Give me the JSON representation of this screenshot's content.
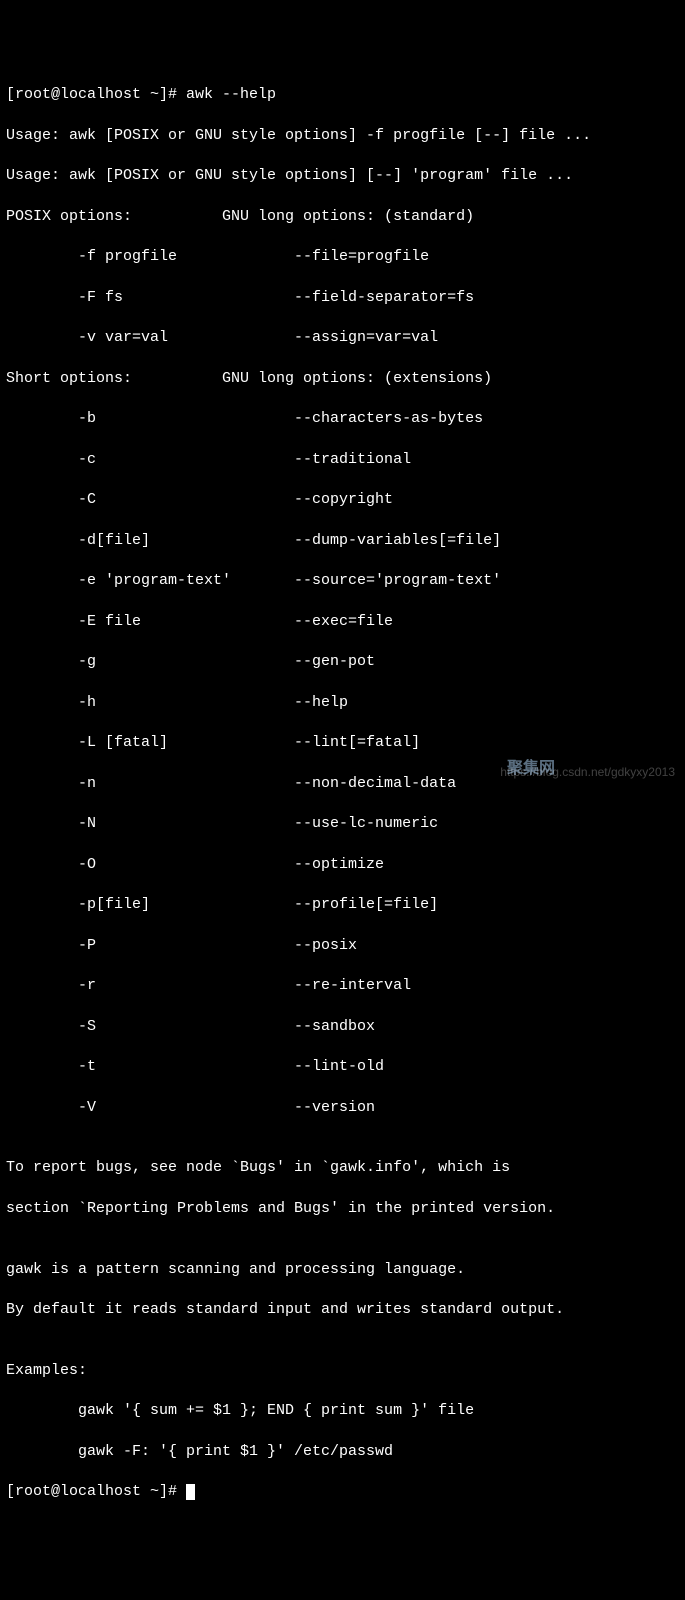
{
  "prompt1": "[root@localhost ~]# awk --help",
  "usage1": "Usage: awk [POSIX or GNU style options] -f progfile [--] file ...",
  "usage2": "Usage: awk [POSIX or GNU style options] [--] 'program' file ...",
  "hdr_posix": "POSIX options:          GNU long options: (standard)",
  "posix_opts": [
    "        -f progfile             --file=progfile",
    "        -F fs                   --field-separator=fs",
    "        -v var=val              --assign=var=val"
  ],
  "hdr_short": "Short options:          GNU long options: (extensions)",
  "short_opts": [
    "        -b                      --characters-as-bytes",
    "        -c                      --traditional",
    "        -C                      --copyright",
    "        -d[file]                --dump-variables[=file]",
    "        -e 'program-text'       --source='program-text'",
    "        -E file                 --exec=file",
    "        -g                      --gen-pot",
    "        -h                      --help",
    "        -L [fatal]              --lint[=fatal]",
    "        -n                      --non-decimal-data",
    "        -N                      --use-lc-numeric",
    "        -O                      --optimize",
    "        -p[file]                --profile[=file]",
    "        -P                      --posix",
    "        -r                      --re-interval",
    "        -S                      --sandbox",
    "        -t                      --lint-old",
    "        -V                      --version"
  ],
  "blank": "",
  "bugs1": "To report bugs, see node `Bugs' in `gawk.info', which is",
  "bugs2": "section `Reporting Problems and Bugs' in the printed version.",
  "desc1": "gawk is a pattern scanning and processing language.",
  "desc2": "By default it reads standard input and writes standard output.",
  "ex_hdr": "Examples:",
  "ex1": "        gawk '{ sum += $1 }; END { print sum }' file",
  "ex2": "        gawk -F: '{ print $1 }' /etc/passwd",
  "prompt2": "[root@localhost ~]# ",
  "watermark_url": "https://blog.csdn.net/gdkyxy2013",
  "watermark_cn": "聚集网"
}
